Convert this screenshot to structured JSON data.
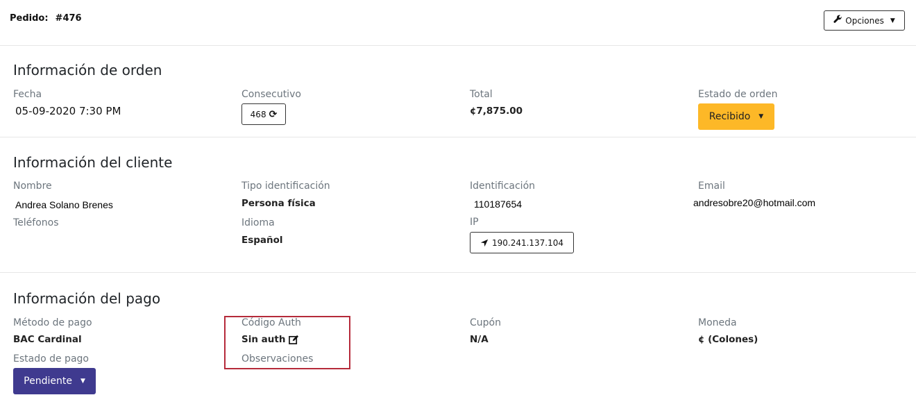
{
  "header": {
    "order_label": "Pedido:",
    "order_number": "#476",
    "options_label": "Opciones"
  },
  "order_info": {
    "title": "Información de orden",
    "date_label": "Fecha",
    "date_value": "05-09-2020 7:30 PM",
    "consecutive_label": "Consecutivo",
    "consecutive_value": "468",
    "total_label": "Total",
    "total_value": "¢7,875.00",
    "status_label": "Estado de orden",
    "status_value": "Recibido"
  },
  "client_info": {
    "title": "Información del cliente",
    "name_label": "Nombre",
    "name_value": "Andrea Solano Brenes",
    "id_type_label": "Tipo identificación",
    "id_type_value": "Persona física",
    "id_label": "Identificación",
    "id_value": "110187654",
    "email_label": "Email",
    "email_value": "andresobre20@hotmail.com",
    "phones_label": "Teléfonos",
    "language_label": "Idioma",
    "language_value": "Español",
    "ip_label": "IP",
    "ip_value": "190.241.137.104"
  },
  "payment_info": {
    "title": "Información del pago",
    "method_label": "Método de pago",
    "method_value": "BAC Cardinal",
    "auth_label": "Código Auth",
    "auth_value": "Sin auth",
    "coupon_label": "Cupón",
    "coupon_value": "N/A",
    "currency_label": "Moneda",
    "currency_value": "¢ (Colones)",
    "payment_status_label": "Estado de pago",
    "payment_status_value": "Pendiente",
    "notes_label": "Observaciones"
  },
  "colors": {
    "accent_orange": "#fdb827",
    "accent_purple": "#3f3a8f",
    "highlight_red": "#b52a3a"
  },
  "icons": {
    "options": "wrench-icon",
    "refresh": "refresh-icon",
    "location": "location-arrow-icon",
    "edit": "edit-icon",
    "caret": "caret-down-icon"
  }
}
